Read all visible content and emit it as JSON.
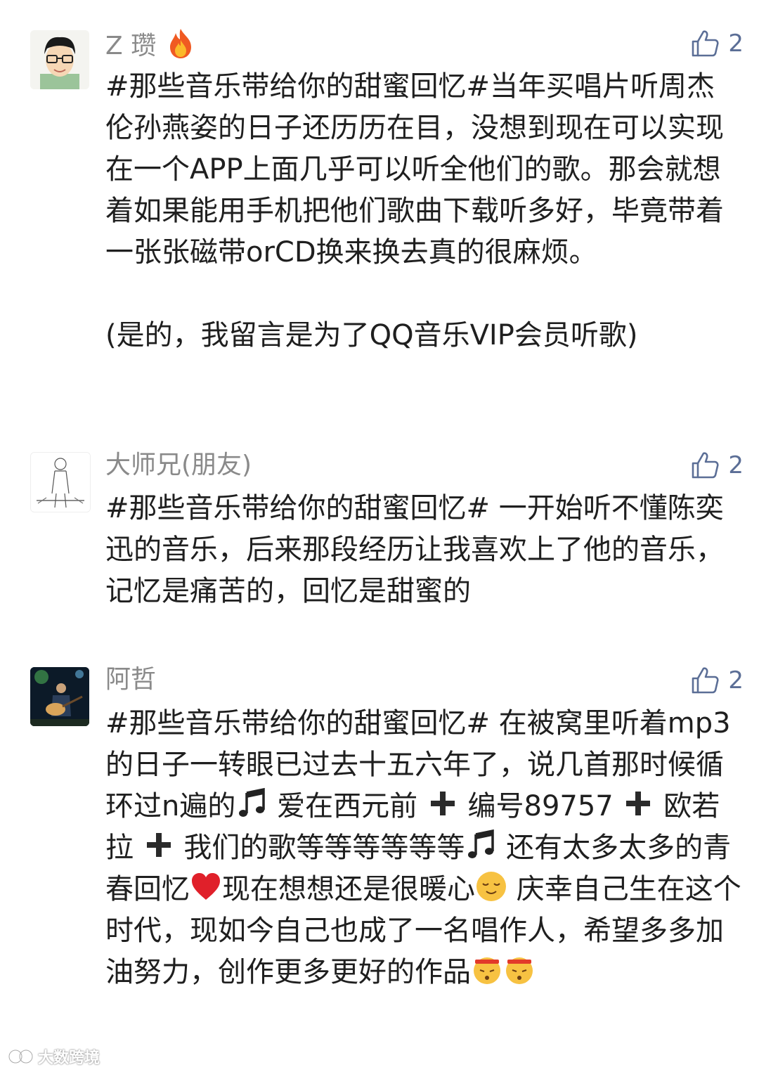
{
  "comments": [
    {
      "name": "Z 瓒",
      "name_emoji": "fire-icon",
      "likes": "2",
      "paragraphs": [
        "#那些音乐带给你的甜蜜回忆#当年买唱片听周杰伦孙燕姿的日子还历历在目，没想到现在可以实现在一个APP上面几乎可以听全他们的歌。那会就想着如果能用手机把他们歌曲下载听多好，毕竟带着一张张磁带orCD换来换去真的很麻烦。",
        "(是的，我留言是为了QQ音乐VIP会员听歌)"
      ]
    },
    {
      "name": "大师兄(朋友)",
      "likes": "2",
      "paragraphs": [
        "#那些音乐带给你的甜蜜回忆# 一开始听不懂陈奕迅的音乐，后来那段经历让我喜欢上了他的音乐，记忆是痛苦的，回忆是甜蜜的"
      ]
    },
    {
      "name": "阿哲",
      "likes": "2",
      "segments": [
        "#那些音乐带给你的甜蜜回忆# 在被窝里听着mp3的日子一转眼已过去十五六年了，说几首那时候循环过n遍的",
        " 爱在西元前 ",
        " 编号89757 ",
        " 欧若拉 ",
        " 我们的歌等等等等等等",
        " 还有太多太多的青春回忆",
        "现在想想还是很暖心",
        " 庆幸自己生在这个时代，现如今自己也成了一名唱作人，希望多多加油努力，创作更多更好的作品"
      ]
    }
  ],
  "watermark": "大数跨境",
  "colors": {
    "name": "#8a8a8a",
    "like": "#5b6e96",
    "text": "#1f1f1f"
  }
}
